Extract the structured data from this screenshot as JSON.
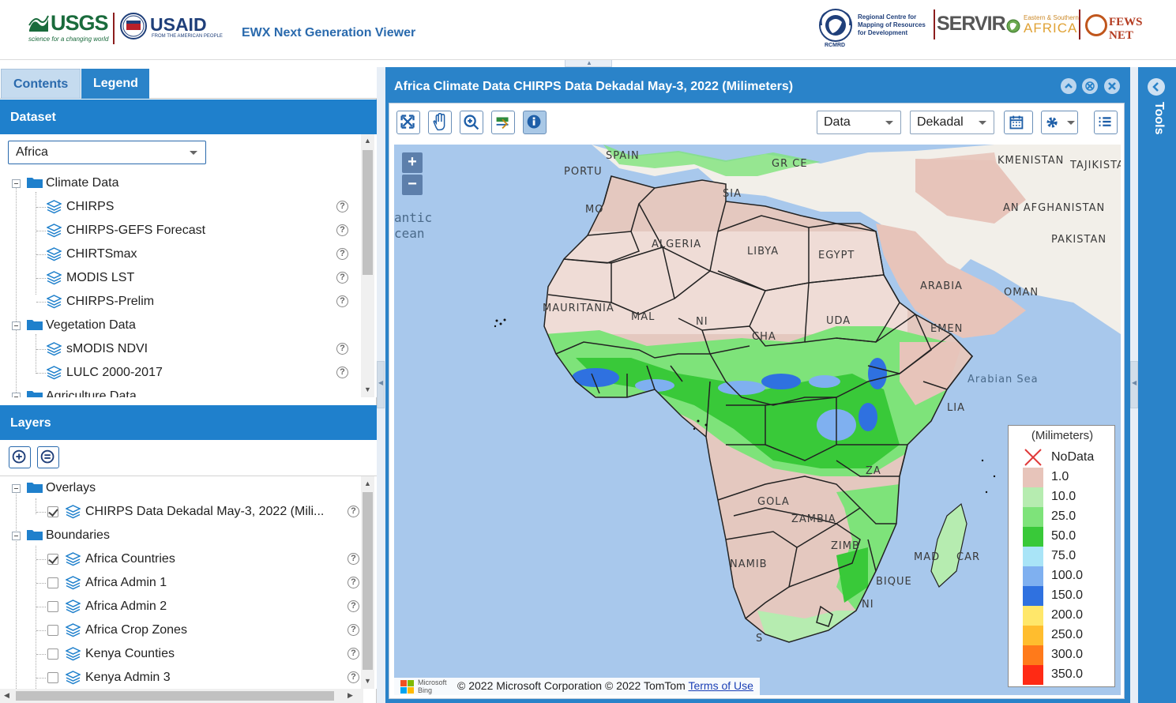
{
  "header": {
    "usgs_logo": "USGS",
    "usgs_tagline": "science for a changing world",
    "usaid_logo": "USAID",
    "usaid_tagline": "FROM THE AMERICAN PEOPLE",
    "app_title": "EWX Next Generation Viewer",
    "rcmrd_text": "Regional Centre for Mapping of Resources for Development",
    "rcmrd_abbr": "RCMRD",
    "servir_logo": "SERVIR",
    "servir_region_top": "Eastern & Southern",
    "servir_region": "AFRICA",
    "fews_logo": "FEWS NET"
  },
  "left_panel": {
    "tabs": [
      {
        "label": "Contents",
        "active": false
      },
      {
        "label": "Legend",
        "active": true
      }
    ],
    "dataset": {
      "header": "Dataset",
      "region_select": "Africa",
      "tree": [
        {
          "label": "Climate Data",
          "type": "folder"
        },
        {
          "label": "CHIRPS",
          "type": "layer"
        },
        {
          "label": "CHIRPS-GEFS Forecast",
          "type": "layer"
        },
        {
          "label": "CHIRTSmax",
          "type": "layer"
        },
        {
          "label": "MODIS LST",
          "type": "layer"
        },
        {
          "label": "CHIRPS-Prelim",
          "type": "layer"
        },
        {
          "label": "Vegetation Data",
          "type": "folder"
        },
        {
          "label": "sMODIS NDVI",
          "type": "layer"
        },
        {
          "label": "LULC 2000-2017",
          "type": "layer"
        },
        {
          "label": "Agriculture Data",
          "type": "folder"
        }
      ],
      "help_glyph": "?"
    },
    "layers": {
      "header": "Layers",
      "tree": [
        {
          "label": "Overlays",
          "type": "folder"
        },
        {
          "label": "CHIRPS Data Dekadal May-3, 2022 (Mili...",
          "type": "layer",
          "checked": true
        },
        {
          "label": "Boundaries",
          "type": "folder"
        },
        {
          "label": "Africa Countries",
          "type": "layer",
          "checked": true
        },
        {
          "label": "Africa Admin 1",
          "type": "layer",
          "checked": false
        },
        {
          "label": "Africa Admin 2",
          "type": "layer",
          "checked": false
        },
        {
          "label": "Africa Crop Zones",
          "type": "layer",
          "checked": false
        },
        {
          "label": "Kenya Counties",
          "type": "layer",
          "checked": false
        },
        {
          "label": "Kenya Admin 3",
          "type": "layer",
          "checked": false
        }
      ]
    }
  },
  "map_window": {
    "title": "Africa Climate Data CHIRPS Data Dekadal May-3, 2022 (Milimeters)",
    "selects": {
      "data": "Data",
      "period": "Dekadal"
    },
    "zoom_in": "+",
    "zoom_out": "−",
    "labels": {
      "portugal": "PORTU",
      "spain": "SPAIN",
      "greece": "GR   CE",
      "tunisia": "SIA",
      "morocco": "MO",
      "algeria": "ALGERIA",
      "libya": "LIBYA",
      "egypt": "EGYPT",
      "mauritania": "MAURITANIA",
      "mali": "MAL",
      "niger": "NI",
      "chad": "CHA",
      "sudan": "UDA",
      "saudi": "ARABIA",
      "oman": "OMAN",
      "yemen": "EMEN",
      "turkmenistan": "KMENISTAN",
      "tajikistan": "TAJIKISTA",
      "afghanistan": "AN  AFGHANISTAN",
      "pakistan": "PAKISTAN",
      "somalia": "LIA",
      "drc": "ZA",
      "angola": "GOLA",
      "zambia": "ZAMBIA",
      "namibia": "NAMIB",
      "mozambique": "BIQUE",
      "madagascar_l": "MAD",
      "madagascar_r": "CAR",
      "zimbabwe": "NI",
      "south": "S",
      "atlantic": "antic",
      "ocean": "cean",
      "arabian_sea": "Arabian Sea",
      "mozamb_chan": "ZIMB"
    },
    "attribution": {
      "ms_line1": "Microsoft",
      "ms_line2": "Bing",
      "text": "© 2022 Microsoft Corporation © 2022 TomTom",
      "link": "Terms of Use"
    },
    "legend": {
      "title": "(Milimeters)",
      "items": [
        {
          "label": "NoData",
          "color": "nodata"
        },
        {
          "label": "1.0",
          "color": "#e7c4ba"
        },
        {
          "label": "10.0",
          "color": "#b6ecb0"
        },
        {
          "label": "25.0",
          "color": "#7ee37a"
        },
        {
          "label": "50.0",
          "color": "#39c939"
        },
        {
          "label": "75.0",
          "color": "#a9e4f7"
        },
        {
          "label": "100.0",
          "color": "#7fb0f0"
        },
        {
          "label": "150.0",
          "color": "#2f71e0"
        },
        {
          "label": "200.0",
          "color": "#ffe76a"
        },
        {
          "label": "250.0",
          "color": "#ffbd2e"
        },
        {
          "label": "300.0",
          "color": "#ff7a1a"
        },
        {
          "label": "350.0",
          "color": "#ff2a14"
        }
      ]
    }
  },
  "tools": {
    "label": "Tools"
  }
}
